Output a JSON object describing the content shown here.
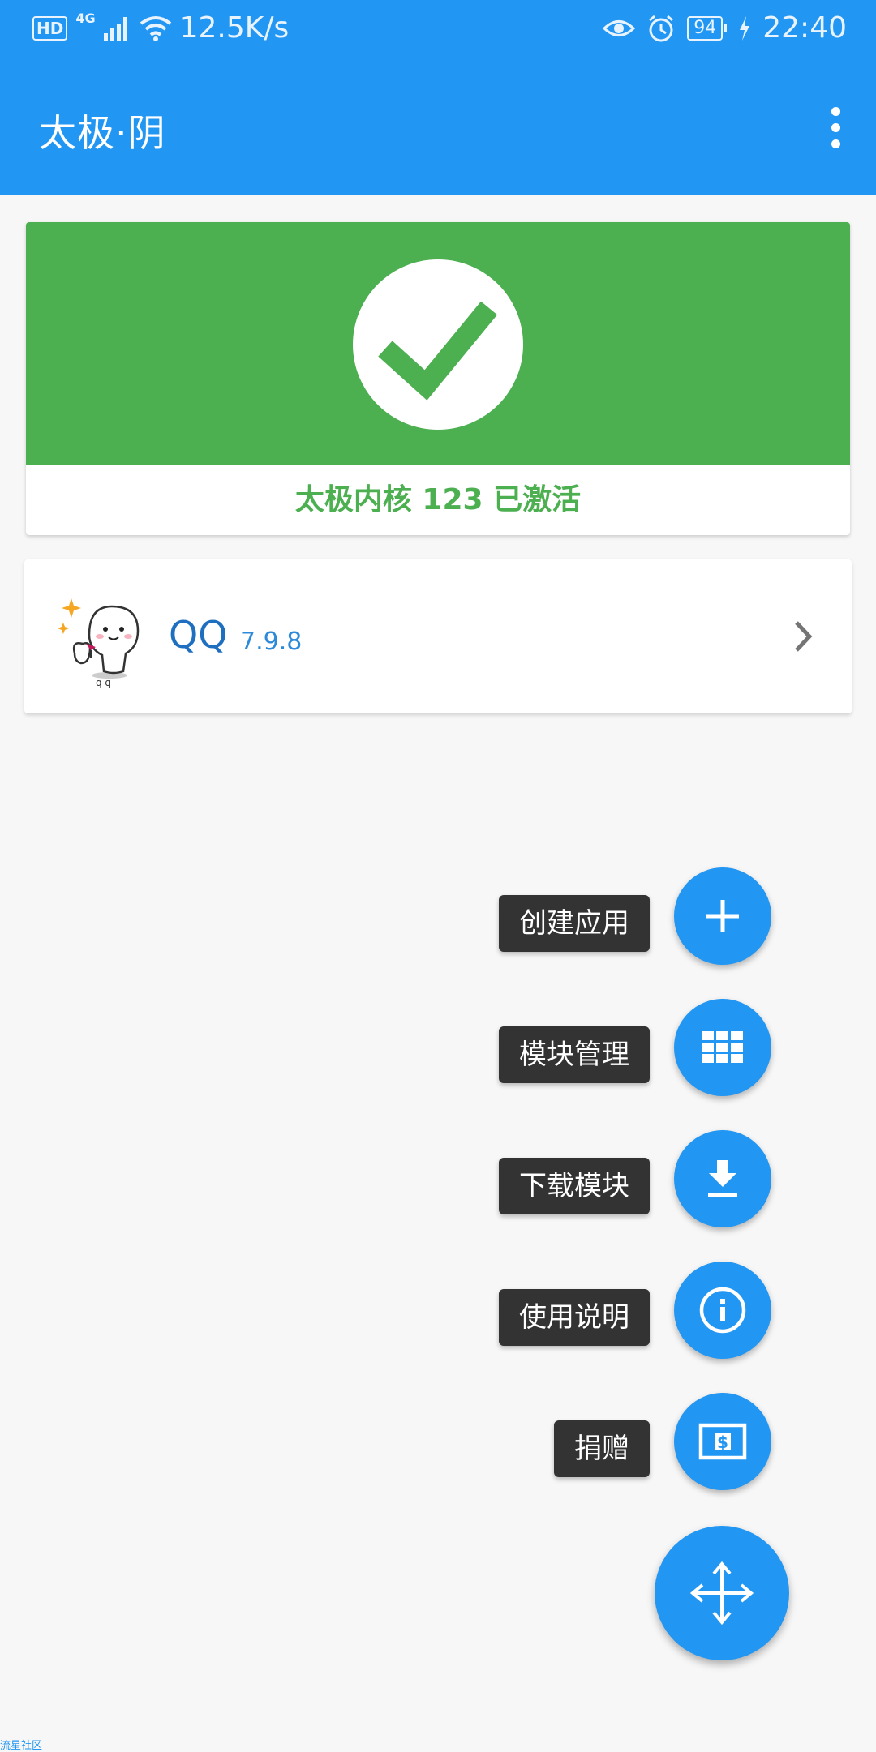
{
  "status_bar": {
    "hd_label": "HD",
    "network_label": "4G",
    "speed": "12.5K/s",
    "battery": "94",
    "time": "22:40",
    "icons": [
      "signal-icon",
      "wifi-icon",
      "eye-icon",
      "alarm-icon",
      "battery-icon",
      "charging-icon"
    ]
  },
  "app_bar": {
    "title": "太极·阴",
    "menu_icon": "more-vert-icon"
  },
  "status_card": {
    "message": "太极内核 123 已激活",
    "icon": "check-circle-icon",
    "color": "#4caf50"
  },
  "apps": [
    {
      "name": "QQ",
      "version": "7.9.8",
      "icon": "qq-app-icon"
    }
  ],
  "fab_menu": {
    "items": [
      {
        "label": "创建应用",
        "icon": "add-icon"
      },
      {
        "label": "模块管理",
        "icon": "grid-icon"
      },
      {
        "label": "下载模块",
        "icon": "download-icon"
      },
      {
        "label": "使用说明",
        "icon": "info-icon"
      },
      {
        "label": "捐赠",
        "icon": "donate-icon"
      }
    ],
    "main_icon": "move-arrows-icon"
  },
  "watermark": "流星社区",
  "colors": {
    "primary": "#2196f3",
    "success": "#4caf50",
    "label_bg": "#333333"
  }
}
